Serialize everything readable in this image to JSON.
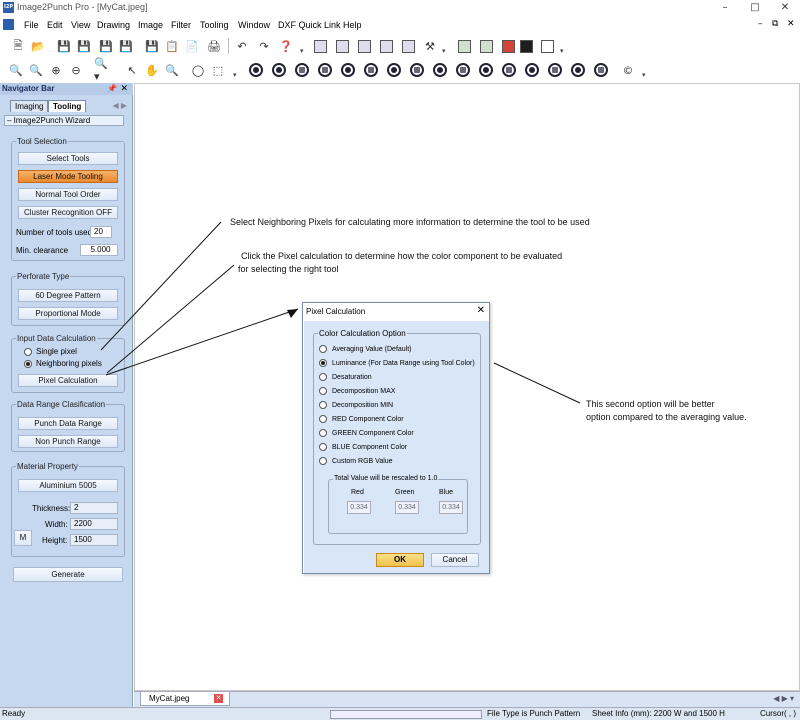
{
  "window": {
    "title": "Image2Punch Pro - [MyCat.jpeg]",
    "app_icon": "I2P"
  },
  "menu": {
    "items": [
      "File",
      "Edit",
      "View",
      "Drawing",
      "Image",
      "Filter",
      "Tooling",
      "Window",
      "DXF Quick Link",
      "Help"
    ]
  },
  "navigator": {
    "title": "Navigator Bar",
    "tabs": [
      "Imaging",
      "Tooling"
    ],
    "active_tab": "Tooling",
    "wizard": "– Image2Punch Wizard",
    "tool_selection": {
      "title": "Tool Selection",
      "select_tools": "Select Tools",
      "laser_mode": "Laser Mode Tooling",
      "normal_order": "Normal Tool Order",
      "cluster": "Cluster Recognition OFF",
      "num_tools_label": "Number of tools used",
      "num_tools_value": "20",
      "min_clearance_label": "Min. clearance",
      "min_clearance_value": "5.000"
    },
    "perforate": {
      "title": "Perforate Type",
      "degree60": "60 Degree Pattern",
      "proportional": "Proportional Mode"
    },
    "input_data": {
      "title": "Input Data Calculation",
      "single": "Single pixel",
      "neighboring": "Neighboring pixels",
      "pixel_calc": "Pixel Calculation"
    },
    "data_range": {
      "title": "Data Range Clasification",
      "punch": "Punch Data Range",
      "nonpunch": "Non Punch Range"
    },
    "material": {
      "title": "Material Property",
      "material": "Aluminium 5005",
      "thickness_label": "Thickness:",
      "thickness": "2",
      "width_label": "Width:",
      "width": "2200",
      "height_label": "Height:",
      "height": "1500",
      "m_button": "M"
    },
    "generate": "Generate"
  },
  "annotations": {
    "a1": "Select Neighboring Pixels for calculating more information to determine the tool to be used",
    "a2_line1": "Click the Pixel calculation to determine how the color component to be evaluated",
    "a2_line2": "for selecting the right tool",
    "a3_line1": "This second option will be better",
    "a3_line2": "option compared to the averaging value."
  },
  "dialog": {
    "title": "Pixel Calculation",
    "group_title": "Color Calculation Option",
    "options": [
      "Averaging Value (Default)",
      "Luminance (For Data Range using Tool Color)",
      "Desaturation",
      "Decomposition MAX",
      "Decomposition MIN",
      "RED Component Color",
      "GREEN Component Color",
      "BLUE Component Color",
      "Custom RGB Value"
    ],
    "selected_option": "Luminance (For Data Range using Tool Color)",
    "sub_title": "Total Value will be rescaled to 1.0",
    "red_label": "Red",
    "green_label": "Green",
    "blue_label": "Blue",
    "red": "0.334",
    "green": "0.334",
    "blue": "0.334",
    "ok": "OK",
    "cancel": "Cancel"
  },
  "document_tab": "MyCat.jpeg",
  "status": {
    "ready": "Ready",
    "file_type": "File Type is Punch Pattern",
    "sheet_info": "Sheet Info (mm): 2200 W and 1500 H",
    "cursor": "Cursor(  , )"
  },
  "colors": {
    "panel_bg": "#c6d8ef",
    "laser_button": "#ea8a2e",
    "ok_button": "#f1c24a"
  }
}
